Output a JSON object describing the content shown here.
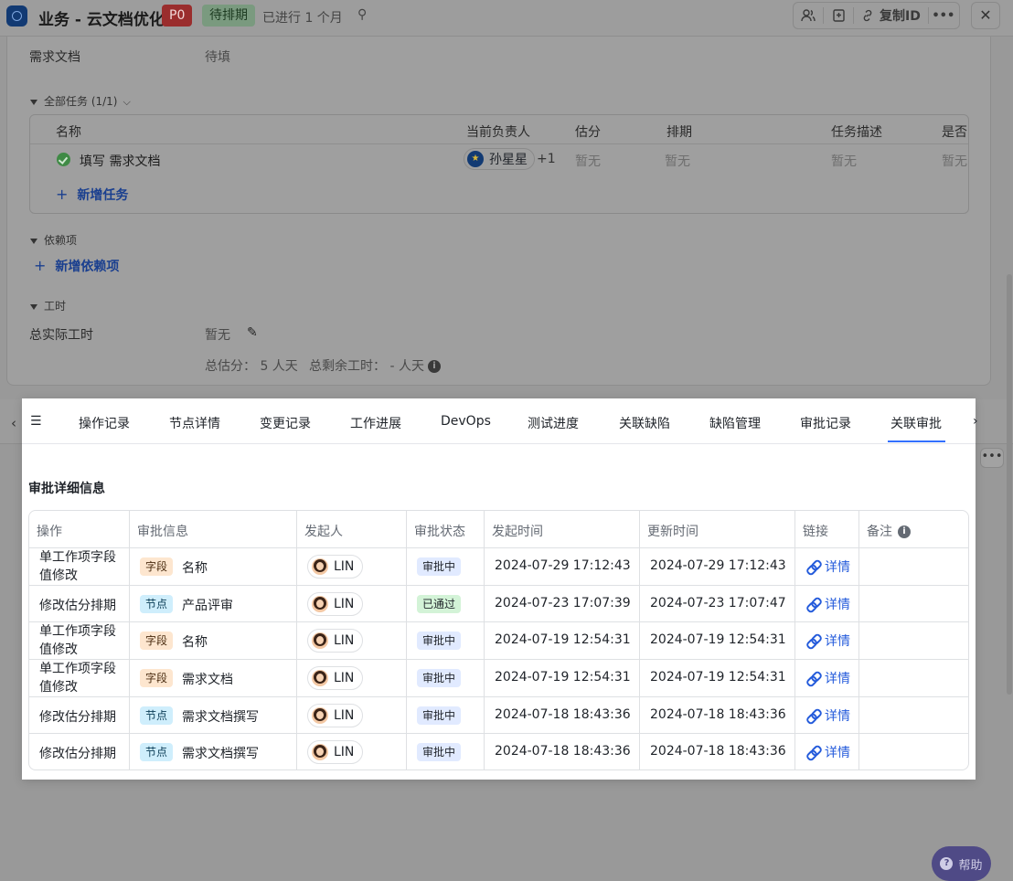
{
  "header": {
    "title": "业务 - 云文档优化",
    "priority": "P0",
    "status": "待排期",
    "elapsed": "已进行 1 个月",
    "copy_id_label": "复制ID"
  },
  "fields": {
    "req_doc_label": "需求文档",
    "req_doc_value": "待填"
  },
  "tasks_section": {
    "title": "全部任务 (1/1)",
    "columns": [
      "名称",
      "当前负责人",
      "估分",
      "排期",
      "任务描述",
      "是否"
    ],
    "rows": [
      {
        "name": "填写 需求文档",
        "owner": "孙星星",
        "owner_extra": "+1",
        "estimate": "暂无",
        "schedule": "暂无",
        "description": "暂无",
        "flag": "暂无"
      }
    ],
    "add_label": "新增任务"
  },
  "dependency_section": {
    "title": "依赖项",
    "add_label": "新增依赖项"
  },
  "worktime_section": {
    "title": "工时",
    "actual_label": "总实际工时",
    "actual_value": "暂无",
    "total_estimate": "总估分： 5 人天",
    "remaining": "总剩余工时： - 人天"
  },
  "tabs": {
    "items": [
      "操作记录",
      "节点详情",
      "变更记录",
      "工作进展",
      "DevOps",
      "测试进度",
      "关联缺陷",
      "缺陷管理",
      "审批记录",
      "关联审批"
    ],
    "active": "关联审批"
  },
  "approval": {
    "title": "审批详细信息",
    "columns": [
      "操作",
      "审批信息",
      "发起人",
      "审批状态",
      "发起时间",
      "更新时间",
      "链接",
      "备注"
    ],
    "rows": [
      {
        "action": "单工作项字段值修改",
        "tag": "字段",
        "tag_type": "field",
        "info": "名称",
        "initiator": "LIN",
        "status": "审批中",
        "status_type": "pending",
        "start": "2024-07-29 17:12:43",
        "updated": "2024-07-29 17:12:43",
        "link": "详情"
      },
      {
        "action": "修改估分排期",
        "tag": "节点",
        "tag_type": "node",
        "info": "产品评审",
        "initiator": "LIN",
        "status": "已通过",
        "status_type": "passed",
        "start": "2024-07-23 17:07:39",
        "updated": "2024-07-23 17:07:47",
        "link": "详情"
      },
      {
        "action": "单工作项字段值修改",
        "tag": "字段",
        "tag_type": "field",
        "info": "名称",
        "initiator": "LIN",
        "status": "审批中",
        "status_type": "pending",
        "start": "2024-07-19 12:54:31",
        "updated": "2024-07-19 12:54:31",
        "link": "详情"
      },
      {
        "action": "单工作项字段值修改",
        "tag": "字段",
        "tag_type": "field",
        "info": "需求文档",
        "initiator": "LIN",
        "status": "审批中",
        "status_type": "pending",
        "start": "2024-07-19 12:54:31",
        "updated": "2024-07-19 12:54:31",
        "link": "详情"
      },
      {
        "action": "修改估分排期",
        "tag": "节点",
        "tag_type": "node",
        "info": "需求文档撰写",
        "initiator": "LIN",
        "status": "审批中",
        "status_type": "pending",
        "start": "2024-07-18 18:43:36",
        "updated": "2024-07-18 18:43:36",
        "link": "详情"
      },
      {
        "action": "修改估分排期",
        "tag": "节点",
        "tag_type": "node",
        "info": "需求文档撰写",
        "initiator": "LIN",
        "status": "审批中",
        "status_type": "pending",
        "start": "2024-07-18 18:43:36",
        "updated": "2024-07-18 18:43:36",
        "link": "详情"
      }
    ]
  },
  "help": {
    "label": "帮助"
  },
  "colors": {
    "accent": "#3370ff",
    "link": "#245bdb",
    "overlay": "#999999"
  }
}
